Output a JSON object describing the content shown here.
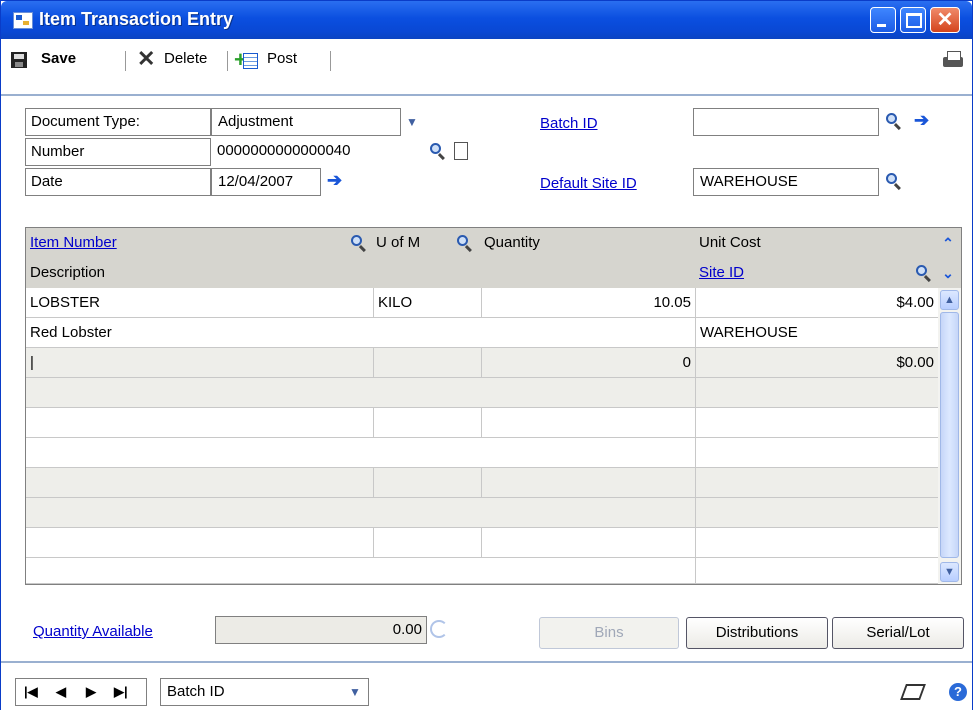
{
  "window": {
    "title": "Item Transaction Entry"
  },
  "toolbar": {
    "save": "Save",
    "delete": "Delete",
    "post": "Post"
  },
  "header": {
    "doc_type_label": "Document Type:",
    "doc_type_value": "Adjustment",
    "number_label": "Number",
    "number_value": "0000000000000040",
    "date_label": "Date",
    "date_value": "12/04/2007",
    "batch_id_label": "Batch ID",
    "batch_id_value": "",
    "default_site_label": "Default Site ID",
    "default_site_value": "WAREHOUSE"
  },
  "grid": {
    "columns": {
      "item_number": "Item Number",
      "uofm": "U of M",
      "quantity": "Quantity",
      "unit_cost": "Unit Cost",
      "description": "Description",
      "site_id": "Site ID"
    },
    "rows": [
      {
        "item": "LOBSTER",
        "uofm": "KILO",
        "qty": "10.05",
        "cost": "$4.00",
        "desc": "Red Lobster",
        "site": "WAREHOUSE"
      },
      {
        "item": "|",
        "uofm": "",
        "qty": "0",
        "cost": "$0.00",
        "desc": "",
        "site": ""
      }
    ]
  },
  "footer": {
    "qty_avail_label": "Quantity Available",
    "qty_avail_value": "0.00",
    "bins": "Bins",
    "distributions": "Distributions",
    "serial_lot": "Serial/Lot"
  },
  "status": {
    "browse_by": "Batch ID"
  }
}
